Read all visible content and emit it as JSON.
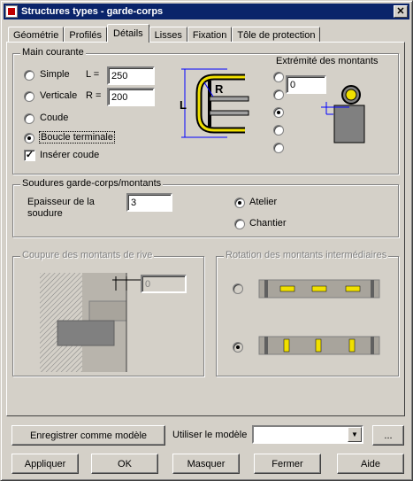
{
  "window": {
    "title": "Structures types - garde-corps"
  },
  "tabs": [
    "Géométrie",
    "Profilés",
    "Détails",
    "Lisses",
    "Fixation",
    "Tôle de protection"
  ],
  "main_courante": {
    "legend": "Main courante",
    "options": [
      "Simple",
      "Verticale",
      "Coude",
      "Boucle terminale"
    ],
    "selected": "Boucle terminale",
    "l_label": "L =",
    "l_value": "250",
    "r_label": "R =",
    "r_value": "200",
    "inserer_coude_label": "Insérer coude",
    "inserer_coude_checked": true,
    "diagram_labels": {
      "l": "L",
      "r": "R"
    }
  },
  "extremite": {
    "label": "Extrémité des montants",
    "value": "0",
    "selected_index": 2
  },
  "soudures": {
    "legend": "Soudures garde-corps/montants",
    "epaisseur_label_1": "Epaisseur de la",
    "epaisseur_label_2": "soudure",
    "epaisseur_value": "3",
    "options": [
      "Atelier",
      "Chantier"
    ],
    "selected": "Atelier"
  },
  "coupure": {
    "legend": "Coupure des montants de rive",
    "value": "0"
  },
  "rotation": {
    "legend": "Rotation des montants intermédiaires",
    "selected_index": 1
  },
  "footer": {
    "save_template": "Enregistrer comme modèle",
    "use_template_label": "Utiliser le modèle",
    "template_value": "",
    "browse": "...",
    "apply": "Appliquer",
    "ok": "OK",
    "hide": "Masquer",
    "close": "Fermer",
    "help": "Aide"
  },
  "colors": {
    "title_bg": "#0a246a",
    "accent_yellow": "#f0e000",
    "dim_blue": "#0000ff"
  }
}
